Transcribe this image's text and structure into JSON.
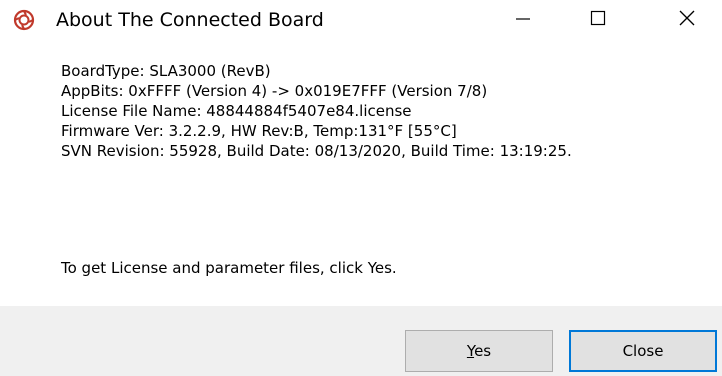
{
  "window": {
    "title": "About The Connected Board",
    "icon": "app-logo-icon",
    "controls": {
      "minimize": "minimize-icon",
      "maximize": "maximize-icon",
      "close": "close-icon"
    }
  },
  "info": {
    "lines": [
      "BoardType: SLA3000 (RevB)",
      "AppBits: 0xFFFF (Version 4) -> 0x019E7FFF (Version 7/8)",
      "License File Name: 48844884f5407e84.license",
      "Firmware Ver: 3.2.2.9, HW Rev:B, Temp:131°F [55°C]",
      "SVN Revision: 55928, Build Date: 08/13/2020, Build Time: 13:19:25."
    ],
    "prompt": "To get License and parameter files, click Yes."
  },
  "buttons": {
    "yes": "Yes",
    "close": "Close"
  },
  "colors": {
    "footer_bg": "#f0f0f0",
    "button_bg": "#e1e1e1",
    "default_button_border": "#0078d7",
    "icon_red": "#c0392b"
  }
}
